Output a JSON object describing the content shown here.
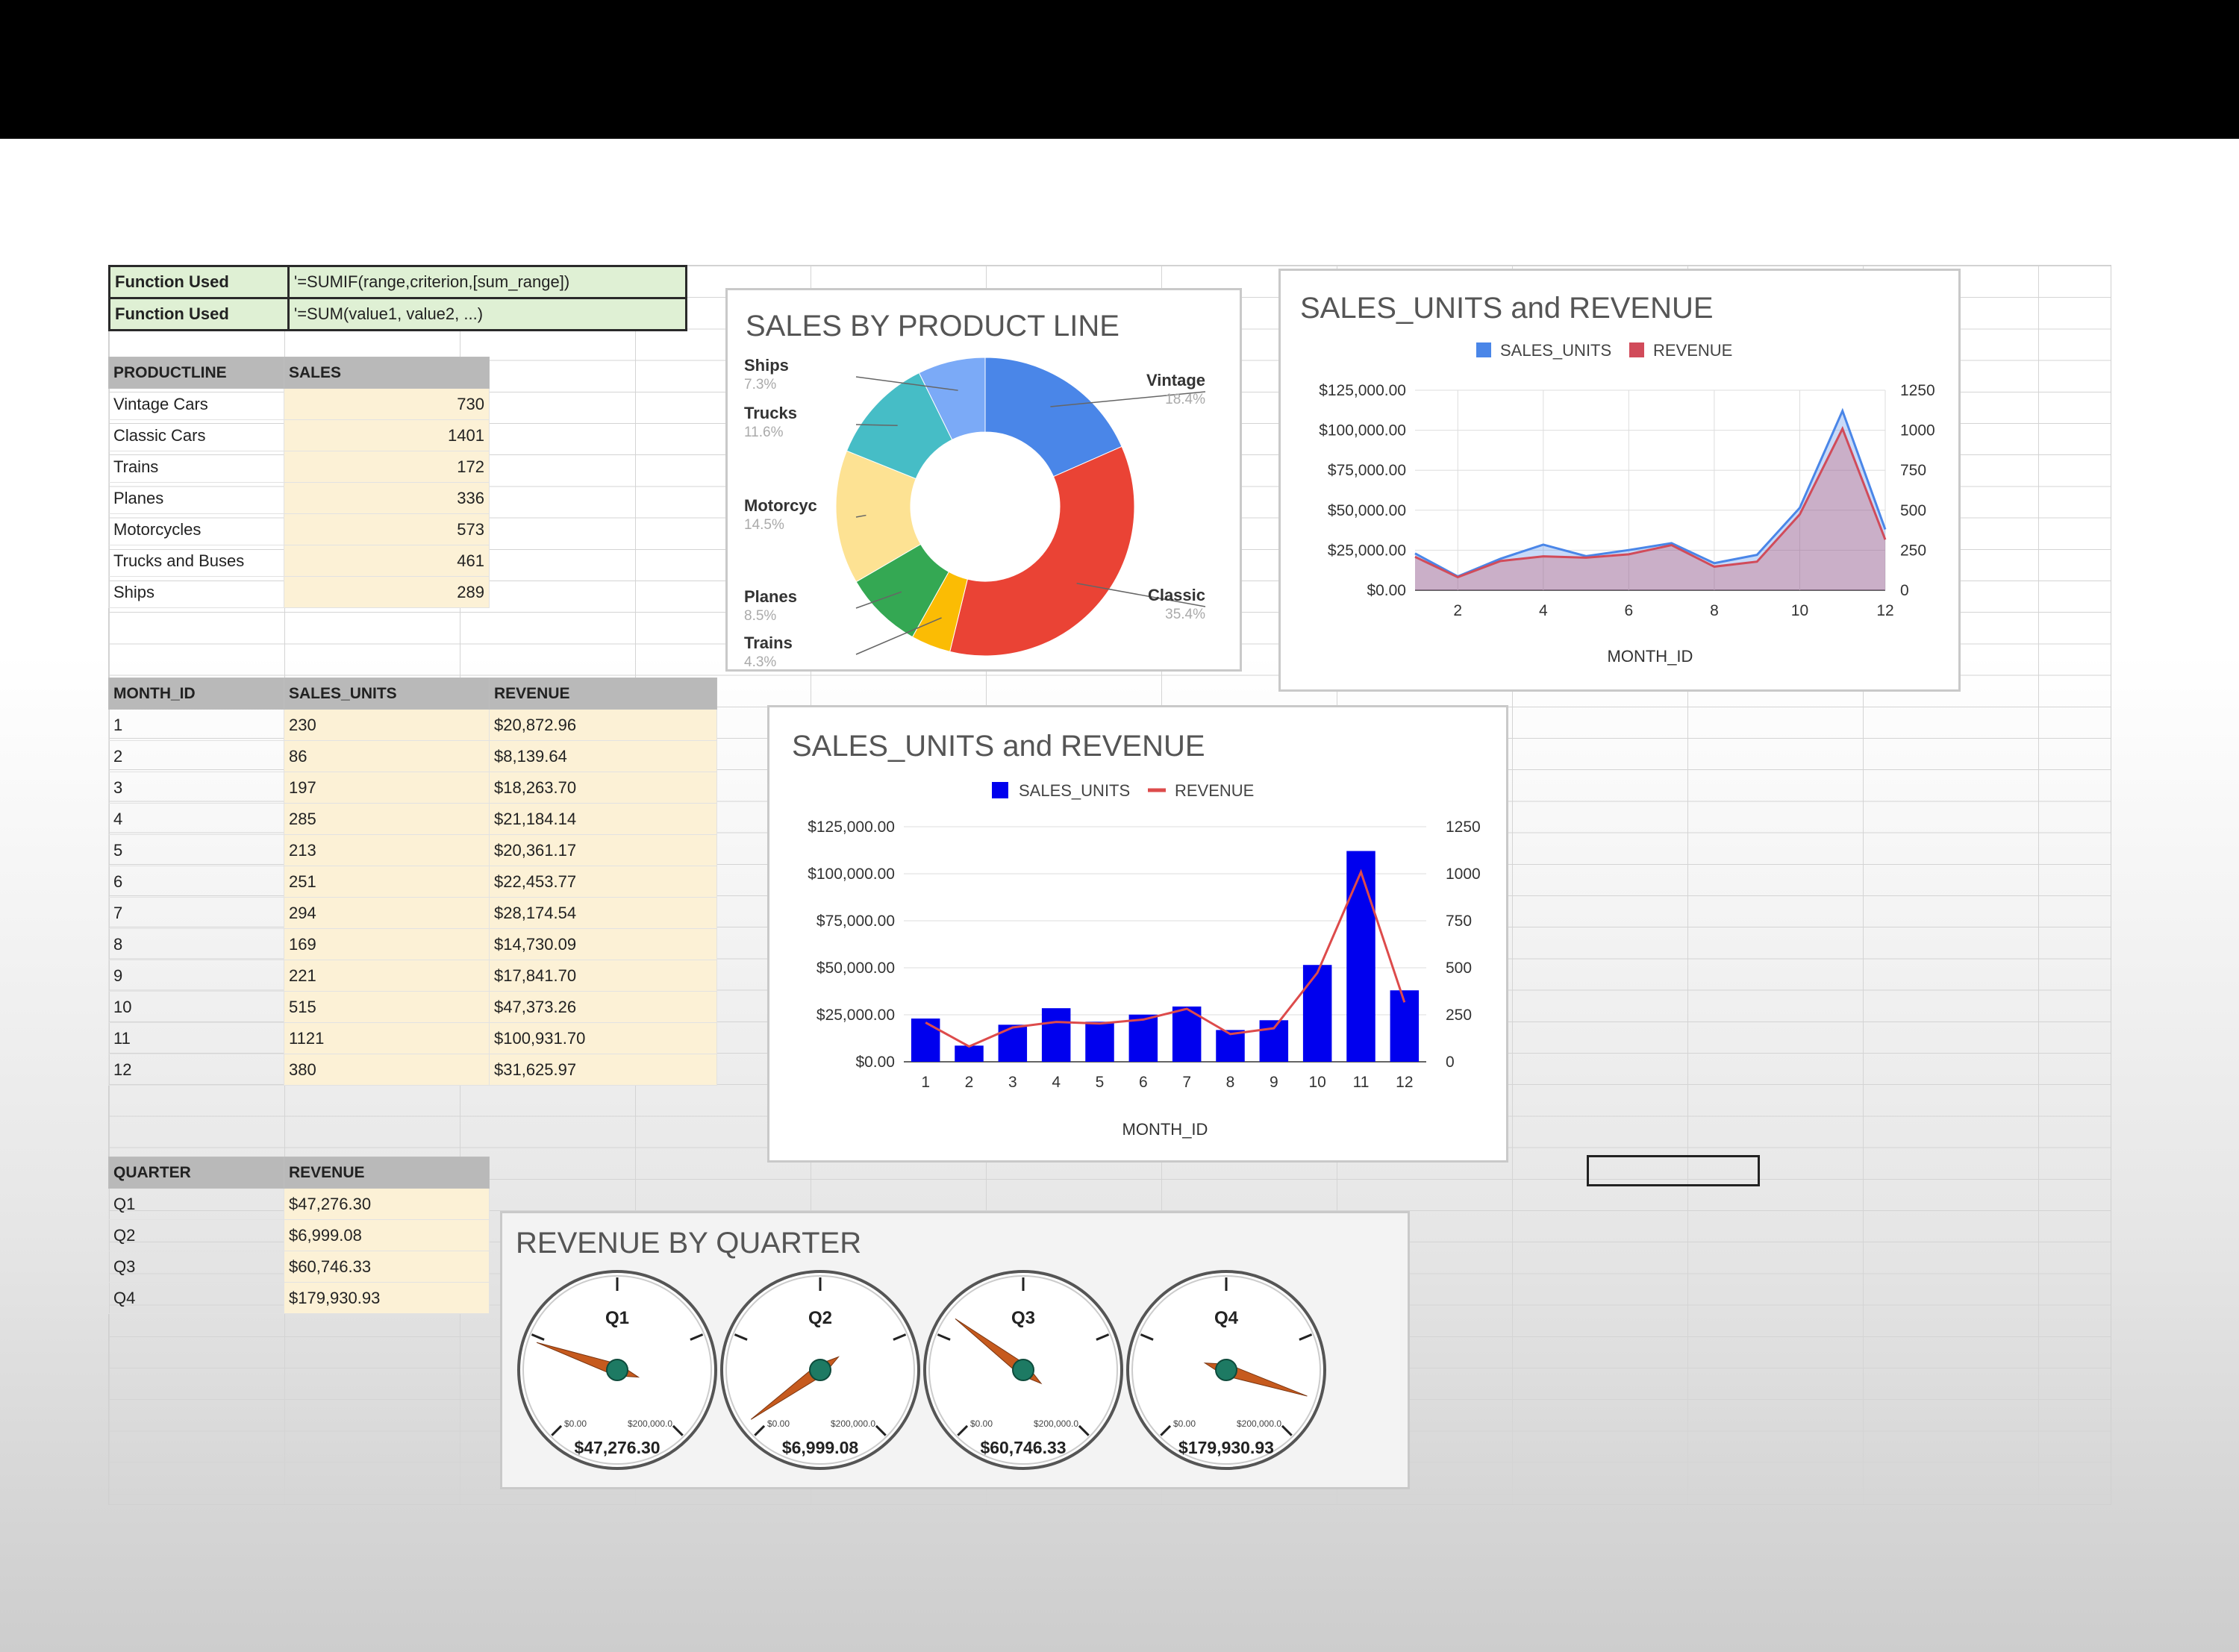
{
  "functions": [
    {
      "label": "Function Used",
      "value": "'=SUMIF(range,criterion,[sum_range])"
    },
    {
      "label": "Function Used",
      "value": "'=SUM(value1, value2, ...)"
    }
  ],
  "product_table": {
    "headers": [
      "PRODUCTLINE",
      "SALES"
    ],
    "rows": [
      {
        "name": "Vintage Cars",
        "sales": "730"
      },
      {
        "name": "Classic Cars",
        "sales": "1401"
      },
      {
        "name": "Trains",
        "sales": "172"
      },
      {
        "name": "Planes",
        "sales": "336"
      },
      {
        "name": "Motorcycles",
        "sales": "573"
      },
      {
        "name": "Trucks and Buses",
        "sales": "461"
      },
      {
        "name": "Ships",
        "sales": "289"
      }
    ]
  },
  "month_table": {
    "headers": [
      "MONTH_ID",
      "SALES_UNITS",
      "REVENUE"
    ],
    "rows": [
      {
        "month": "1",
        "units": "230",
        "revenue": "$20,872.96"
      },
      {
        "month": "2",
        "units": "86",
        "revenue": "$8,139.64"
      },
      {
        "month": "3",
        "units": "197",
        "revenue": "$18,263.70"
      },
      {
        "month": "4",
        "units": "285",
        "revenue": "$21,184.14"
      },
      {
        "month": "5",
        "units": "213",
        "revenue": "$20,361.17"
      },
      {
        "month": "6",
        "units": "251",
        "revenue": "$22,453.77"
      },
      {
        "month": "7",
        "units": "294",
        "revenue": "$28,174.54"
      },
      {
        "month": "8",
        "units": "169",
        "revenue": "$14,730.09"
      },
      {
        "month": "9",
        "units": "221",
        "revenue": "$17,841.70"
      },
      {
        "month": "10",
        "units": "515",
        "revenue": "$47,373.26"
      },
      {
        "month": "11",
        "units": "1121",
        "revenue": "$100,931.70"
      },
      {
        "month": "12",
        "units": "380",
        "revenue": "$31,625.97"
      }
    ]
  },
  "quarter_table": {
    "headers": [
      "QUARTER",
      "REVENUE"
    ],
    "rows": [
      {
        "quarter": "Q1",
        "revenue": "$47,276.30"
      },
      {
        "quarter": "Q2",
        "revenue": "$6,999.08"
      },
      {
        "quarter": "Q3",
        "revenue": "$60,746.33"
      },
      {
        "quarter": "Q4",
        "revenue": "$179,930.93"
      }
    ]
  },
  "chart_data": [
    {
      "type": "pie",
      "title": "SALES BY PRODUCT LINE",
      "donut": true,
      "slices": [
        {
          "label": "Vintage",
          "pct": "18.4%",
          "value": 18.4,
          "color": "#4a86e8"
        },
        {
          "label": "Classic",
          "pct": "35.4%",
          "value": 35.4,
          "color": "#ea4335"
        },
        {
          "label": "Trains",
          "pct": "4.3%",
          "value": 4.3,
          "color": "#fbbc04"
        },
        {
          "label": "Planes",
          "pct": "8.5%",
          "value": 8.5,
          "color": "#34a853"
        },
        {
          "label": "Motorcyc",
          "pct": "14.5%",
          "value": 14.5,
          "color": "#fde293"
        },
        {
          "label": "Trucks",
          "pct": "11.6%",
          "value": 11.6,
          "color": "#46bdc6"
        },
        {
          "label": "Ships",
          "pct": "7.3%",
          "value": 7.3,
          "color": "#7baaf7"
        }
      ]
    },
    {
      "type": "area",
      "title": "SALES_UNITS and REVENUE",
      "xlabel": "MONTH_ID",
      "x": [
        1,
        2,
        3,
        4,
        5,
        6,
        7,
        8,
        9,
        10,
        11,
        12
      ],
      "x_ticks": [
        "2",
        "4",
        "6",
        "8",
        "10",
        "12"
      ],
      "xlim": [
        1,
        12
      ],
      "left_ticks": [
        "$0.00",
        "$25,000.00",
        "$50,000.00",
        "$75,000.00",
        "$100,000.00",
        "$125,000.00"
      ],
      "right_ticks": [
        "0",
        "250",
        "500",
        "750",
        "1000",
        "1250"
      ],
      "ylim_left": [
        0,
        125000
      ],
      "ylim_right": [
        0,
        1250
      ],
      "legend_position": "top",
      "series": [
        {
          "name": "SALES_UNITS",
          "axis": "right",
          "color": "#4a86e8",
          "values": [
            230,
            86,
            197,
            285,
            213,
            251,
            294,
            169,
            221,
            515,
            1121,
            380
          ]
        },
        {
          "name": "REVENUE",
          "axis": "left",
          "color": "#d14b5a",
          "values": [
            20872.96,
            8139.64,
            18263.7,
            21184.14,
            20361.17,
            22453.77,
            28174.54,
            14730.09,
            17841.7,
            47373.26,
            100931.7,
            31625.97
          ]
        }
      ]
    },
    {
      "type": "bar",
      "title": "SALES_UNITS and REVENUE",
      "xlabel": "MONTH_ID",
      "categories": [
        "1",
        "2",
        "3",
        "4",
        "5",
        "6",
        "7",
        "8",
        "9",
        "10",
        "11",
        "12"
      ],
      "left_ticks": [
        "$0.00",
        "$25,000.00",
        "$50,000.00",
        "$75,000.00",
        "$100,000.00",
        "$125,000.00"
      ],
      "right_ticks": [
        "0",
        "250",
        "500",
        "750",
        "1000",
        "1250"
      ],
      "ylim_left": [
        0,
        125000
      ],
      "ylim_right": [
        0,
        1250
      ],
      "legend_position": "top",
      "series": [
        {
          "name": "SALES_UNITS",
          "type": "bar",
          "axis": "right",
          "color": "#0000ee",
          "values": [
            230,
            86,
            197,
            285,
            213,
            251,
            294,
            169,
            221,
            515,
            1121,
            380
          ]
        },
        {
          "name": "REVENUE",
          "type": "line",
          "axis": "left",
          "color": "#dd4b4b",
          "values": [
            20872.96,
            8139.64,
            18263.7,
            21184.14,
            20361.17,
            22453.77,
            28174.54,
            14730.09,
            17841.7,
            47373.26,
            100931.7,
            31625.97
          ]
        }
      ]
    },
    {
      "type": "gauge",
      "title": "REVENUE BY QUARTER",
      "min_label": "$0.00",
      "max_label": "$200,000.0",
      "range": [
        0,
        200000
      ],
      "gauges": [
        {
          "label": "Q1",
          "value": 47276.3,
          "display": "$47,276.30"
        },
        {
          "label": "Q2",
          "value": 6999.08,
          "display": "$6,999.08"
        },
        {
          "label": "Q3",
          "value": 60746.33,
          "display": "$60,746.33"
        },
        {
          "label": "Q4",
          "value": 179930.93,
          "display": "$179,930.93"
        }
      ]
    }
  ]
}
